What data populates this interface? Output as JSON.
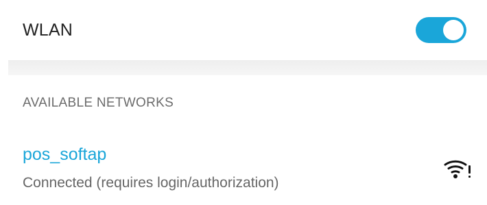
{
  "colors": {
    "accent": "#1aa6d9"
  },
  "wlan": {
    "title": "WLAN",
    "toggle_on": true
  },
  "available_networks": {
    "header": "AVAILABLE NETWORKS",
    "items": [
      {
        "ssid": "pos_softap",
        "status": "Connected (requires login/authorization)",
        "icon": "wifi-signal-alert-icon"
      }
    ]
  }
}
